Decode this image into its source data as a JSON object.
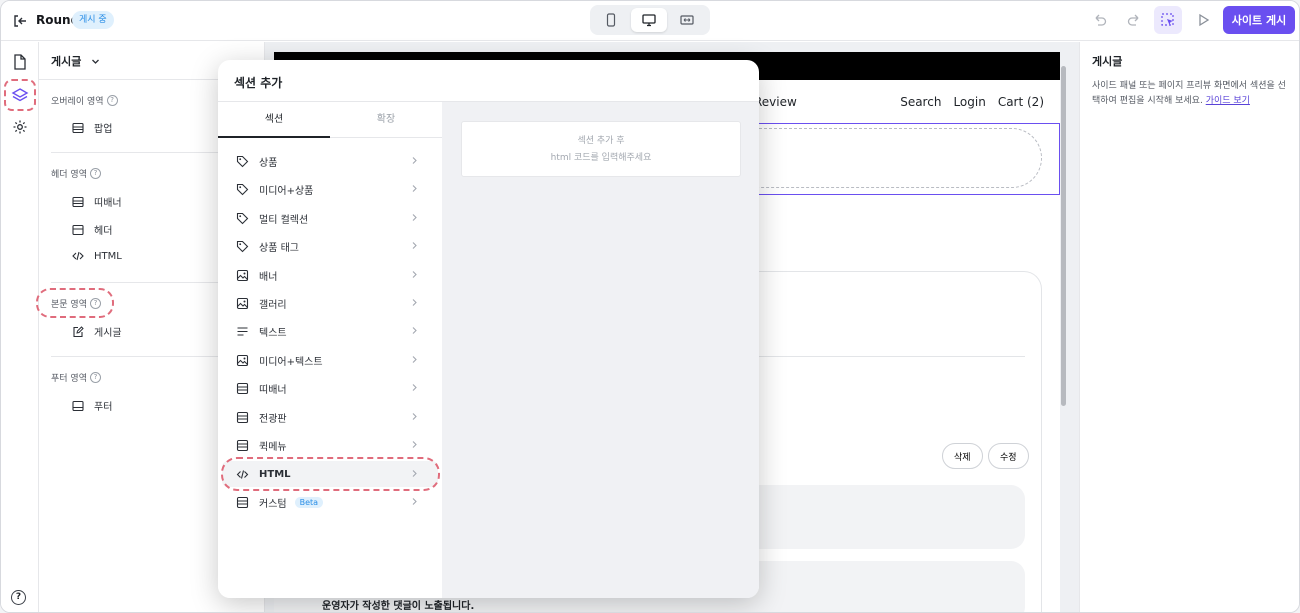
{
  "topbar": {
    "site_name": "Round",
    "status_badge": "게시 중",
    "publish_label": "사이트 게시"
  },
  "layers_panel": {
    "title": "게시글",
    "groups": [
      {
        "label": "오버레이 영역",
        "items": [
          "팝업"
        ]
      },
      {
        "label": "헤더 영역",
        "items": [
          "띠배너",
          "헤더",
          "HTML"
        ]
      },
      {
        "label": "본문 영역",
        "items": [
          "게시글"
        ]
      },
      {
        "label": "푸터 영역",
        "items": [
          "푸터"
        ]
      }
    ]
  },
  "modal": {
    "title": "섹션 추가",
    "tabs": [
      "섹션",
      "확장"
    ],
    "sections": [
      {
        "label": "상품",
        "icon": "tag-icon"
      },
      {
        "label": "미디어+상품",
        "icon": "tag-icon"
      },
      {
        "label": "멀티 컬렉션",
        "icon": "tag-icon"
      },
      {
        "label": "상품 태그",
        "icon": "tag-icon"
      },
      {
        "label": "배너",
        "icon": "image-icon"
      },
      {
        "label": "갤러리",
        "icon": "image-icon"
      },
      {
        "label": "텍스트",
        "icon": "text-align-icon"
      },
      {
        "label": "미디어+텍스트",
        "icon": "image-icon"
      },
      {
        "label": "띠배너",
        "icon": "layout-icon"
      },
      {
        "label": "전광판",
        "icon": "layout-icon"
      },
      {
        "label": "퀵메뉴",
        "icon": "layout-icon"
      },
      {
        "label": "HTML",
        "icon": "code-icon"
      },
      {
        "label": "커스텀",
        "icon": "layout-icon",
        "badge": "Beta"
      }
    ],
    "preview_line1": "섹션 추가 후",
    "preview_line2": "html 코드를 입력해주세요"
  },
  "canvas": {
    "nav_review": "Review",
    "nav_search": "Search",
    "nav_login": "Login",
    "nav_cart": "Cart (2)",
    "delete_label": "삭제",
    "edit_label": "수정",
    "footer_note": "운영자가 작성한 댓글이 노출됩니다."
  },
  "right_panel": {
    "title": "게시글",
    "description": "사이드 패널 또는 페이지 프리뷰 화면에서 섹션을 선택하여 편집을 시작해 보세요.",
    "guide_link": "가이드 보기"
  },
  "colors": {
    "accent": "#6a4ff0",
    "highlight_dash": "#e06c7c",
    "badge_bg": "#dff0fd",
    "badge_text": "#2a8ee6"
  }
}
